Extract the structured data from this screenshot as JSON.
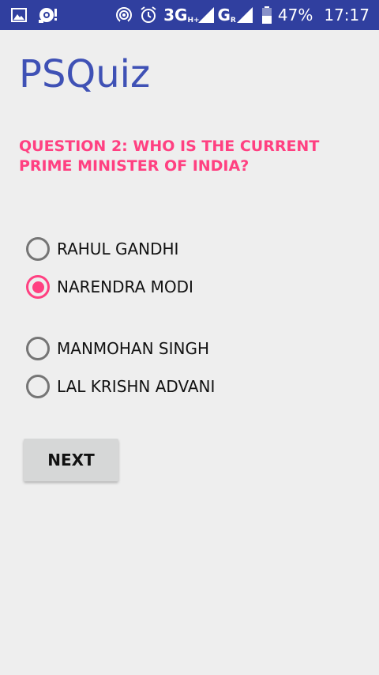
{
  "status_bar": {
    "icons_left": [
      "image-icon",
      "sync-alert-icon"
    ],
    "hotspot_icon": "hotspot-icon",
    "alarm_icon": "alarm-icon",
    "network1": "3G",
    "network1_sup": "H+",
    "network2": "G",
    "network2_sup": "R",
    "battery": "47%",
    "time": "17:17"
  },
  "app": {
    "title": "PSQuiz"
  },
  "quiz": {
    "question": "QUESTION 2: WHO IS THE CURRENT PRIME MINISTER OF INDIA?",
    "options": [
      {
        "label": "RAHUL GANDHI",
        "checked": false
      },
      {
        "label": "NARENDRA MODI",
        "checked": true
      },
      {
        "label": "MANMOHAN SINGH",
        "checked": false
      },
      {
        "label": "LAL KRISHN ADVANI",
        "checked": false
      }
    ],
    "next_label": "NEXT"
  },
  "colors": {
    "status_bar": "#303f9f",
    "primary": "#3f51b5",
    "accent": "#ff4081",
    "background": "#eeeeee"
  }
}
